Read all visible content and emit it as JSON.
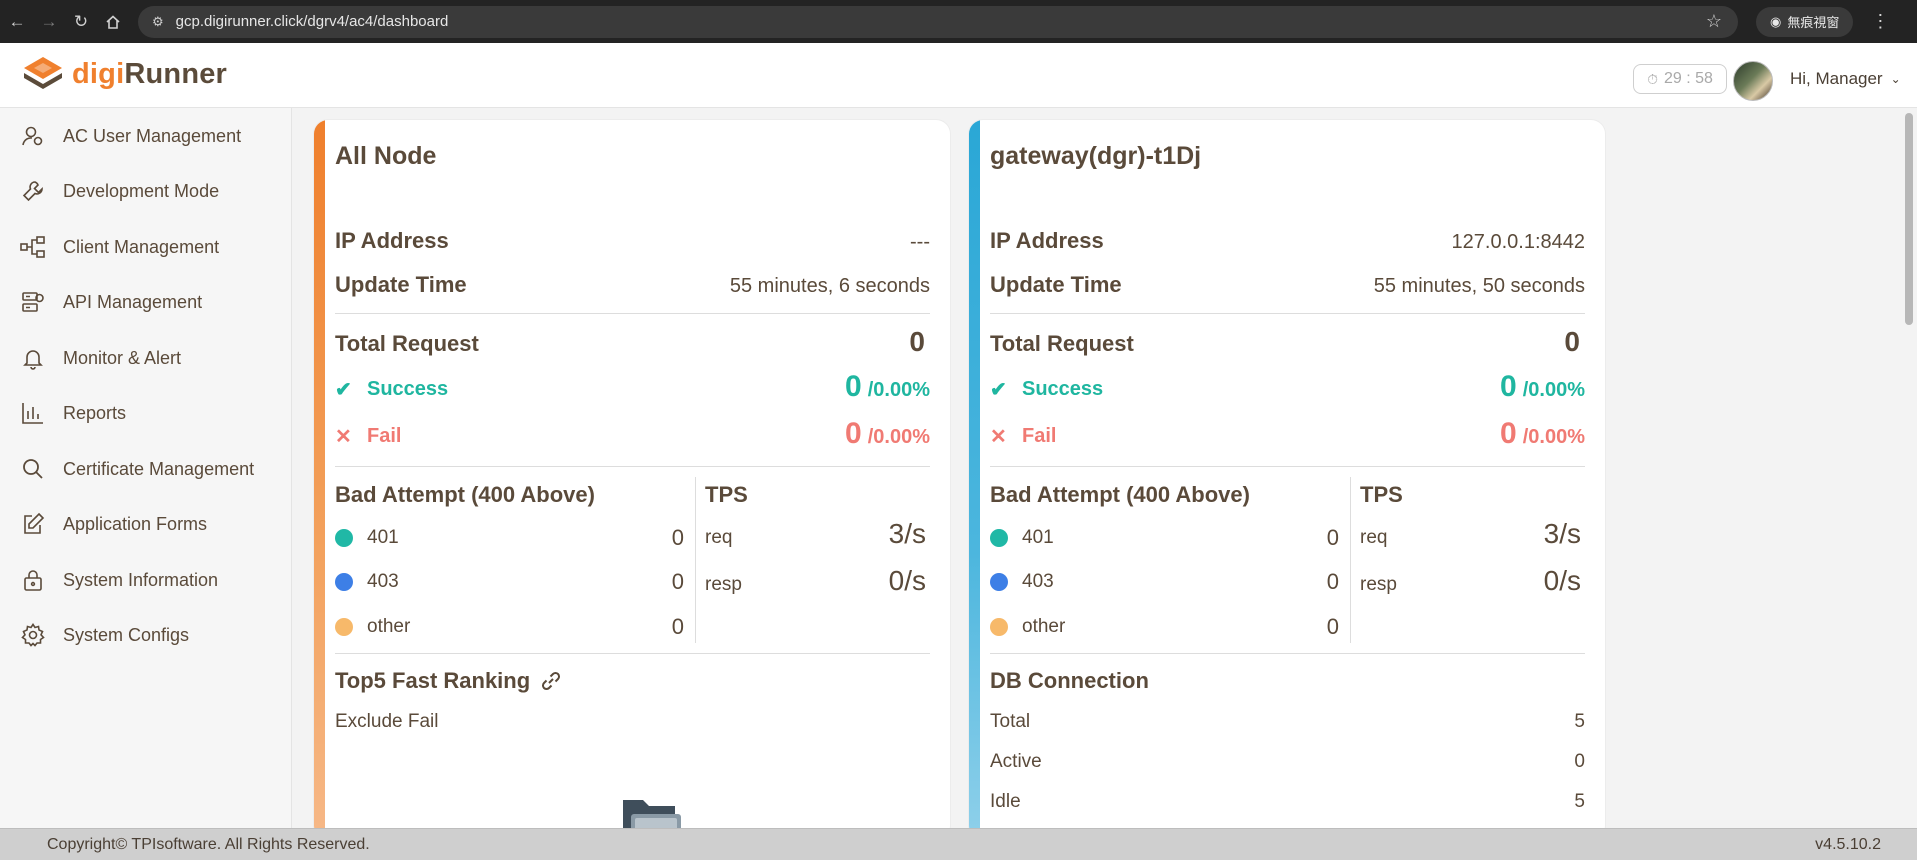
{
  "browser": {
    "url": "gcp.digirunner.click/dgrv4/ac4/dashboard",
    "incognito_label": "無痕視窗"
  },
  "header": {
    "logo_prefix": "digi",
    "logo_suffix": "Runner",
    "timer": "29 : 58",
    "greeting": "Hi, Manager"
  },
  "sidebar": {
    "items": [
      {
        "label": "AC User Management",
        "icon": "user-management-icon"
      },
      {
        "label": "Development Mode",
        "icon": "wrench-icon"
      },
      {
        "label": "Client Management",
        "icon": "hierarchy-icon"
      },
      {
        "label": "API Management",
        "icon": "api-server-icon"
      },
      {
        "label": "Monitor & Alert",
        "icon": "bell-icon"
      },
      {
        "label": "Reports",
        "icon": "bar-chart-icon"
      },
      {
        "label": "Certificate Management",
        "icon": "search-icon"
      },
      {
        "label": "Application Forms",
        "icon": "edit-icon"
      },
      {
        "label": "System Information",
        "icon": "lock-icon"
      },
      {
        "label": "System Configs",
        "icon": "gear-icon"
      }
    ]
  },
  "cards": [
    {
      "title": "All Node",
      "ip_label": "IP Address",
      "ip_value": "---",
      "update_label": "Update Time",
      "update_value": "55 minutes, 6 seconds",
      "total_label": "Total Request",
      "total_value": "0",
      "success_label": "Success",
      "success_value": "0",
      "success_pct": "/0.00%",
      "fail_label": "Fail",
      "fail_value": "0",
      "fail_pct": "/0.00%",
      "bad_title": "Bad Attempt (400 Above)",
      "bad": [
        {
          "label": "401",
          "count": "0"
        },
        {
          "label": "403",
          "count": "0"
        },
        {
          "label": "other",
          "count": "0"
        }
      ],
      "tps_title": "TPS",
      "tps": [
        {
          "label": "req",
          "value": "3/s"
        },
        {
          "label": "resp",
          "value": "0/s"
        }
      ],
      "bottom_title": "Top5 Fast Ranking",
      "bottom_sub": "Exclude Fail"
    },
    {
      "title": "gateway(dgr)-t1Dj",
      "ip_label": "IP Address",
      "ip_value": "127.0.0.1:8442",
      "update_label": "Update Time",
      "update_value": "55 minutes, 50 seconds",
      "total_label": "Total Request",
      "total_value": "0",
      "success_label": "Success",
      "success_value": "0",
      "success_pct": "/0.00%",
      "fail_label": "Fail",
      "fail_value": "0",
      "fail_pct": "/0.00%",
      "bad_title": "Bad Attempt (400 Above)",
      "bad": [
        {
          "label": "401",
          "count": "0"
        },
        {
          "label": "403",
          "count": "0"
        },
        {
          "label": "other",
          "count": "0"
        }
      ],
      "tps_title": "TPS",
      "tps": [
        {
          "label": "req",
          "value": "3/s"
        },
        {
          "label": "resp",
          "value": "0/s"
        }
      ],
      "db_title": "DB Connection",
      "db": [
        {
          "label": "Total",
          "value": "5"
        },
        {
          "label": "Active",
          "value": "0"
        },
        {
          "label": "Idle",
          "value": "5"
        }
      ]
    }
  ],
  "colors": {
    "brand_orange": "#f0802e",
    "brand_brown": "#5b4b3a",
    "success": "#1fb6a0",
    "fail": "#f07a73",
    "dot_401": "#20b8a6",
    "dot_403": "#3d7fe6",
    "dot_other": "#f7b96a"
  },
  "footer": {
    "copyright": "Copyright© TPIsoftware. All Rights Reserved.",
    "version": "v4.5.10.2"
  }
}
